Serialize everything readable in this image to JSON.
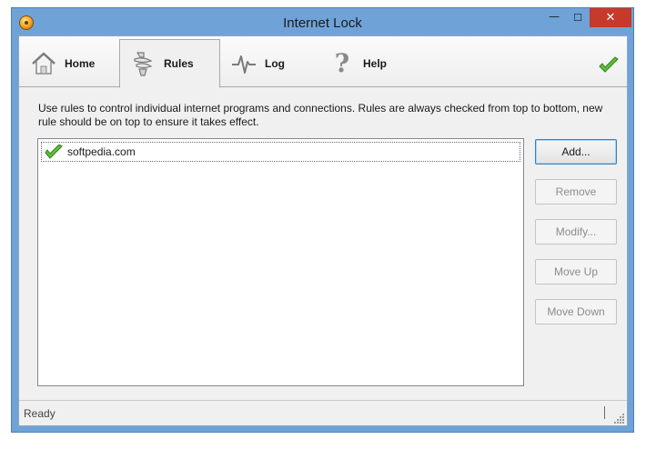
{
  "window": {
    "title": "Internet Lock",
    "controls": {
      "minimize": "—",
      "maximize": "☐",
      "close": "✕"
    }
  },
  "tabs": [
    {
      "label": "Home",
      "icon": "home-icon",
      "active": false
    },
    {
      "label": "Rules",
      "icon": "rules-icon",
      "active": true
    },
    {
      "label": "Log",
      "icon": "log-icon",
      "active": false
    },
    {
      "label": "Help",
      "icon": "help-icon",
      "active": false
    }
  ],
  "help_glyph": "?",
  "description": "Use rules to control individual internet programs and connections. Rules are always checked from top to bottom, new rule should be on top to ensure it takes effect.",
  "rules": [
    {
      "name": "softpedia.com",
      "enabled": true
    }
  ],
  "buttons": {
    "add": "Add...",
    "remove": "Remove",
    "modify": "Modify...",
    "move_up": "Move Up",
    "move_down": "Move Down"
  },
  "status": {
    "text": "Ready"
  },
  "colors": {
    "accent_check": "#4caf2a",
    "window_frame": "#6fa3d8",
    "close_button": "#c7392a"
  }
}
